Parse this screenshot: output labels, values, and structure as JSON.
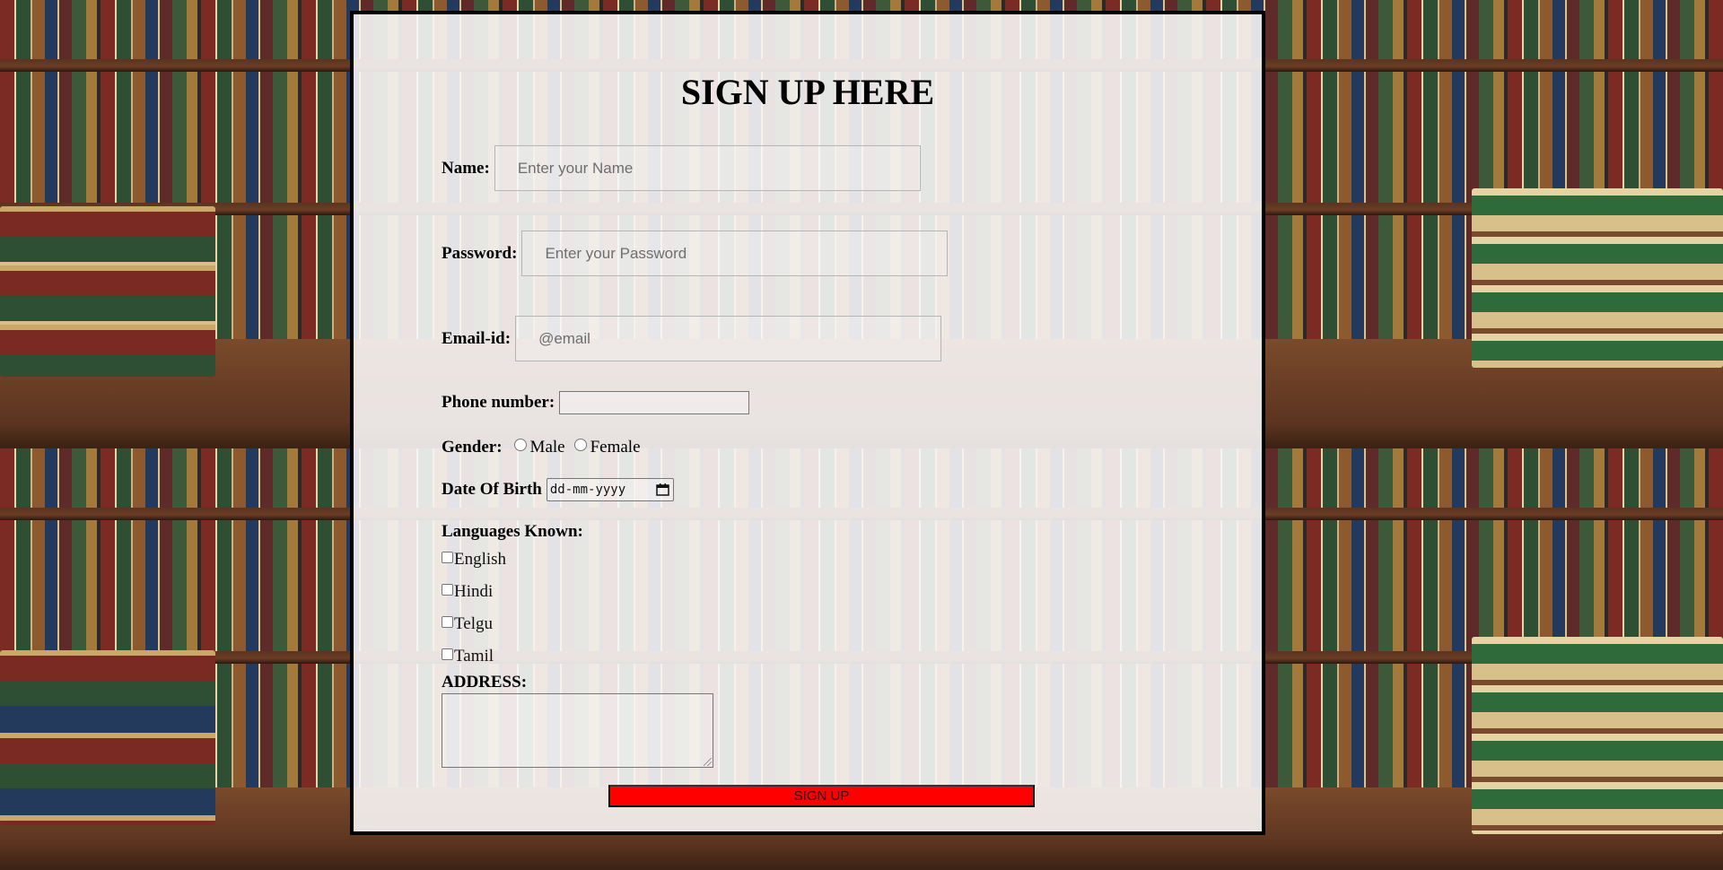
{
  "form": {
    "title": "SIGN UP HERE",
    "name": {
      "label": "Name:",
      "placeholder": "Enter your Name",
      "value": ""
    },
    "password": {
      "label": "Password:",
      "placeholder": "Enter your Password",
      "value": ""
    },
    "email": {
      "label": "Email-id:",
      "placeholder": "@email",
      "value": ""
    },
    "phone": {
      "label": "Phone number:",
      "value": ""
    },
    "gender": {
      "label": "Gender:",
      "options": [
        "Male",
        "Female"
      ]
    },
    "dob": {
      "label": "Date Of Birth",
      "placeholder": "dd-mm-yyyy"
    },
    "languages": {
      "label": "Languages Known:",
      "options": [
        "English",
        "Hindi",
        "Telgu",
        "Tamil"
      ]
    },
    "address": {
      "label": "ADDRESS:",
      "value": ""
    },
    "submit_label": "SIGN UP"
  },
  "colors": {
    "panel_border": "#000000",
    "submit_background": "#ff0000"
  }
}
